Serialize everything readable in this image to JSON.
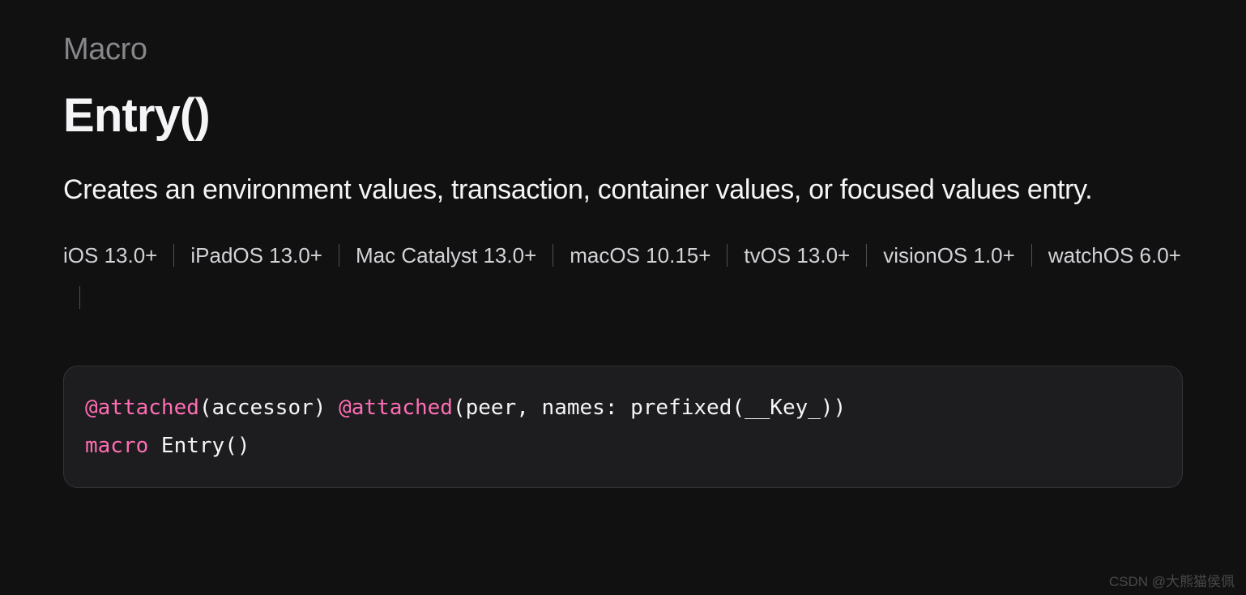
{
  "eyebrow": "Macro",
  "title": "Entry()",
  "summary": "Creates an environment values, transaction, container values, or focused values entry.",
  "platforms": [
    "iOS 13.0+",
    "iPadOS 13.0+",
    "Mac Catalyst 13.0+",
    "macOS 10.15+",
    "tvOS 13.0+",
    "visionOS 1.0+",
    "watchOS 6.0+"
  ],
  "code": {
    "tokens": [
      {
        "t": "@attached",
        "c": "kw"
      },
      {
        "t": "(accessor) ",
        "c": "plain"
      },
      {
        "t": "@attached",
        "c": "kw"
      },
      {
        "t": "(peer, names: prefixed(__Key_))",
        "c": "plain"
      },
      {
        "t": "\n",
        "c": "plain"
      },
      {
        "t": "macro",
        "c": "kw"
      },
      {
        "t": " Entry()",
        "c": "plain"
      }
    ]
  },
  "watermark": "CSDN @大熊猫侯佩"
}
